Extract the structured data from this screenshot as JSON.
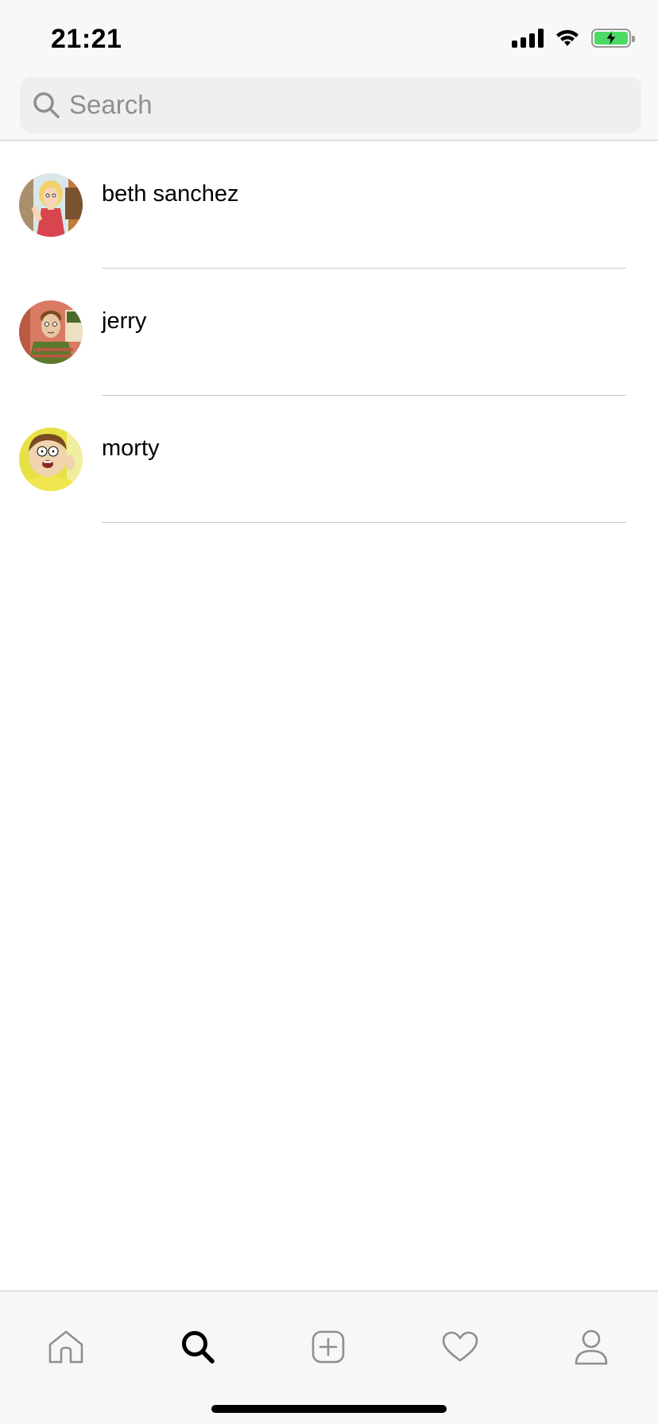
{
  "status_bar": {
    "time": "21:21"
  },
  "search": {
    "placeholder": "Search",
    "value": ""
  },
  "results": [
    {
      "name": "beth sanchez",
      "avatar": "beth-avatar"
    },
    {
      "name": "jerry",
      "avatar": "jerry-avatar"
    },
    {
      "name": "morty",
      "avatar": "morty-avatar"
    }
  ],
  "tabbar": {
    "items": [
      {
        "icon": "home-icon",
        "active": false
      },
      {
        "icon": "search-icon",
        "active": true
      },
      {
        "icon": "add-icon",
        "active": false
      },
      {
        "icon": "heart-icon",
        "active": false
      },
      {
        "icon": "profile-icon",
        "active": false
      }
    ]
  },
  "colors": {
    "header_bg": "#f8f8f8",
    "search_bg": "#efeff0",
    "placeholder": "#8e8e93",
    "separator": "#c8c8cc",
    "battery_fill": "#4cd964",
    "tab_inactive": "#8e8e93",
    "tab_active": "#000000"
  }
}
